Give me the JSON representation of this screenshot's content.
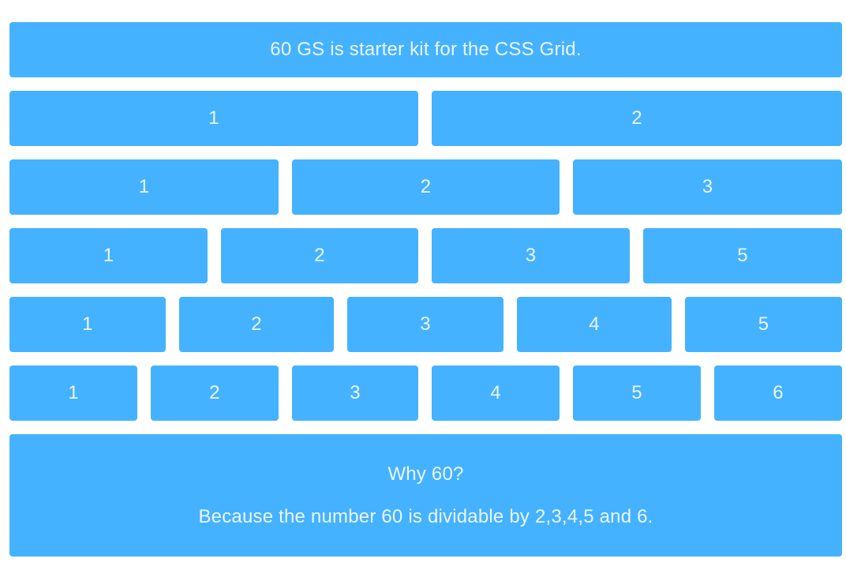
{
  "header": {
    "text": "60 GS is starter kit for the CSS Grid."
  },
  "rows": [
    {
      "cells": [
        "1",
        "2"
      ]
    },
    {
      "cells": [
        "1",
        "2",
        "3"
      ]
    },
    {
      "cells": [
        "1",
        "2",
        "3",
        "5"
      ]
    },
    {
      "cells": [
        "1",
        "2",
        "3",
        "4",
        "5"
      ]
    },
    {
      "cells": [
        "1",
        "2",
        "3",
        "4",
        "5",
        "6"
      ]
    }
  ],
  "footer": {
    "question": "Why 60?",
    "answer": "Because the number 60 is dividable by 2,3,4,5 and 6."
  },
  "colors": {
    "block": "#45b2ff",
    "text": "#eaf6ff",
    "background": "#ffffff"
  }
}
